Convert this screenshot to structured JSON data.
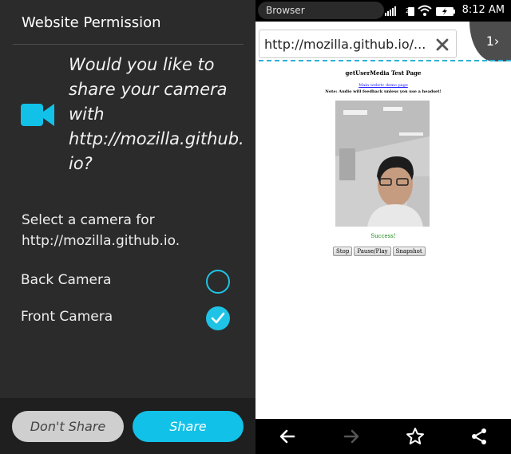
{
  "permission_panel": {
    "header_title": "Website Permission",
    "question": "Would you like to share your camera with http://mozilla.github.io?",
    "select_label": "Select a camera for http://mozilla.github.io.",
    "options": [
      {
        "label": "Back Camera",
        "checked": false
      },
      {
        "label": "Front Camera",
        "checked": true
      }
    ],
    "dont_share_label": "Don't Share",
    "share_label": "Share",
    "accent_color": "#12c1e8",
    "camera_icon": "video-camera-icon"
  },
  "status_bar": {
    "app_name": "Browser",
    "signal_label": "2",
    "time": "8:12 AM"
  },
  "browser": {
    "url": "http://mozilla.github.io/...",
    "tab_count": "1",
    "clear_icon": "close-icon"
  },
  "webpage": {
    "title": "getUserMedia Test Page",
    "link": "Main webrtc demo page",
    "note": "Note: Audio will feedback unless you use a headset!",
    "status": "Success!",
    "buttons": [
      "Stop",
      "Pause/Play",
      "Snapshot"
    ]
  },
  "nav_bar": {
    "icons": [
      "back-arrow-icon",
      "forward-arrow-icon",
      "star-icon",
      "share-icon"
    ]
  }
}
